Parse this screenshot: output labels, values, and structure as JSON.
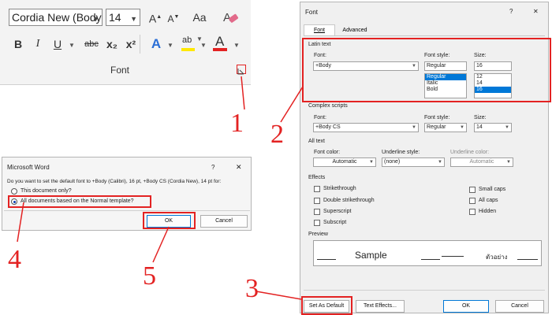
{
  "ribbon": {
    "font_name": "Cordia New (Body",
    "font_size": "14",
    "group_label": "Font",
    "grow_label": "A",
    "shrink_label": "A",
    "case_label": "Aa",
    "bold": "B",
    "italic": "I",
    "underline": "U",
    "strike": "abc",
    "subscript": "x₂",
    "superscript": "x²",
    "effects": "A",
    "highlight": "ab",
    "font_color": "A"
  },
  "font_dialog": {
    "title": "Font",
    "help": "?",
    "close": "✕",
    "tabs": [
      "Font",
      "Advanced"
    ],
    "latin": {
      "section": "Latin text",
      "font_label": "Font:",
      "font_value": "+Body",
      "style_label": "Font style:",
      "style_value": "Regular",
      "style_options": [
        "Regular",
        "Italic",
        "Bold"
      ],
      "size_label": "Size:",
      "size_value": "16",
      "size_options": [
        "12",
        "14",
        "16"
      ]
    },
    "complex": {
      "section": "Complex scripts",
      "font_label": "Font:",
      "font_value": "+Body CS",
      "style_label": "Font style:",
      "style_value": "Regular",
      "size_label": "Size:",
      "size_value": "14"
    },
    "all_text": {
      "section": "All text",
      "color_label": "Font color:",
      "color_value": "Automatic",
      "underline_label": "Underline style:",
      "underline_value": "(none)",
      "ucolor_label": "Underline color:",
      "ucolor_value": "Automatic"
    },
    "effects": {
      "section": "Effects",
      "left": [
        "Strikethrough",
        "Double strikethrough",
        "Superscript",
        "Subscript"
      ],
      "right": [
        "Small caps",
        "All caps",
        "Hidden"
      ]
    },
    "preview": {
      "section": "Preview",
      "sample": "Sample",
      "thai": "ตัวอย่าง"
    },
    "buttons": {
      "set_default": "Set As Default",
      "text_effects": "Text Effects...",
      "ok": "OK",
      "cancel": "Cancel"
    }
  },
  "word_dialog": {
    "title": "Microsoft Word",
    "help": "?",
    "close": "✕",
    "question": "Do you want to set the default font to +Body (Calibri), 16 pt, +Body CS (Cordia New), 14 pt for:",
    "option1": "This document only?",
    "option2": "All documents based on the Normal template?",
    "ok": "OK",
    "cancel": "Cancel"
  },
  "steps": [
    "1",
    "2",
    "3",
    "4",
    "5"
  ],
  "colors": {
    "annotation": "#e32222",
    "selection": "#0078d7"
  }
}
